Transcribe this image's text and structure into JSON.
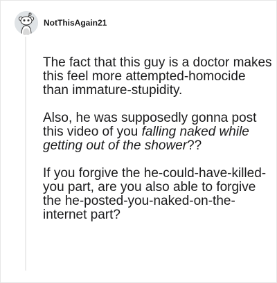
{
  "comment": {
    "username": "NotThisAgain21",
    "avatar_icon": "reddit-snoo-avatar-icon",
    "paragraph_1": "The fact that this guy is a doctor makes this feel more attempted-homocide than immature-stupidity.",
    "paragraph_2_start": "Also, he was supposedly gonna post this video of you ",
    "paragraph_2_italic": "falling naked while getting out of the shower",
    "paragraph_2_end": "??",
    "paragraph_3": "If you forgive the he-could-have-killed-you part, are you also able to forgive the he-posted-you-naked-on-the-internet part?"
  },
  "colors": {
    "text": "#1a1a1b",
    "thread_line": "#ececec",
    "background": "#ffffff"
  }
}
